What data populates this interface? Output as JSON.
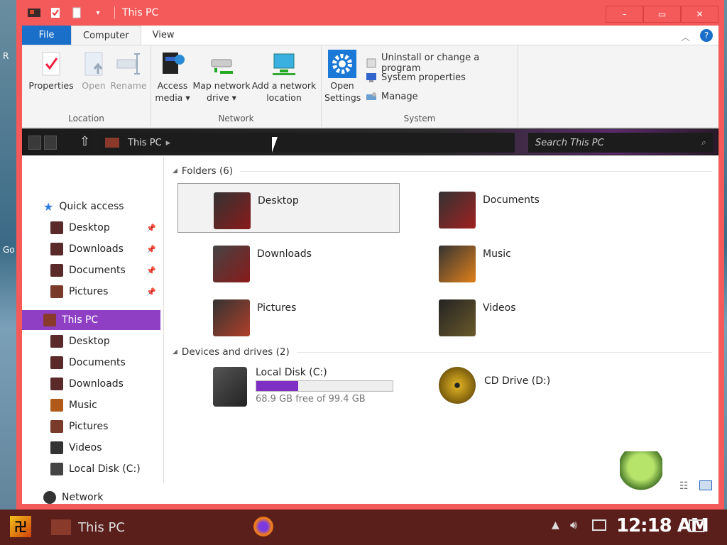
{
  "window": {
    "title": "This PC",
    "controls": {
      "minimize": "–",
      "maximize": "▭",
      "close": "✕"
    }
  },
  "desktop": {
    "text_r": "R",
    "text_go": "Go"
  },
  "ribbon": {
    "tabs": [
      "File",
      "Computer",
      "View"
    ],
    "location": {
      "label": "Location",
      "properties": "Properties",
      "open": "Open",
      "rename": "Rename"
    },
    "network": {
      "label": "Network",
      "access_media_1": "Access",
      "access_media_2": "media ▾",
      "map_drive_1": "Map network",
      "map_drive_2": "drive ▾",
      "add_location_1": "Add a network",
      "add_location_2": "location"
    },
    "system": {
      "label": "System",
      "open_settings_1": "Open",
      "open_settings_2": "Settings",
      "uninstall": "Uninstall or change a program",
      "system_properties": "System properties",
      "manage": "Manage"
    }
  },
  "address": {
    "path": "This PC",
    "search_placeholder": "Search This PC"
  },
  "nav": {
    "quick_access": "Quick access",
    "quick_items": [
      "Desktop",
      "Downloads",
      "Documents",
      "Pictures"
    ],
    "this_pc": "This PC",
    "pc_items": [
      "Desktop",
      "Documents",
      "Downloads",
      "Music",
      "Pictures",
      "Videos",
      "Local Disk (C:)"
    ],
    "network": "Network"
  },
  "content": {
    "folders_header": "Folders (6)",
    "folders": [
      "Desktop",
      "Documents",
      "Downloads",
      "Music",
      "Pictures",
      "Videos"
    ],
    "drives_header": "Devices and drives (2)",
    "drive_c": {
      "name": "Local Disk (C:)",
      "free": "68.9 GB free of 99.4 GB",
      "used_fraction": 0.307
    },
    "drive_d": {
      "name": "CD Drive (D:)"
    }
  },
  "taskbar": {
    "app": "This PC",
    "clock": "12:18 AM"
  },
  "colors": {
    "frame": "#f45a5a",
    "selection": "#8e3fc4",
    "file_tab": "#1a6fc9",
    "taskbar": "#5a1f1a"
  }
}
